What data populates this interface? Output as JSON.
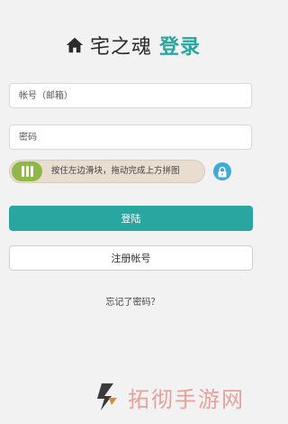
{
  "header": {
    "home_icon": "home-icon",
    "site_name": "宅之魂",
    "title": "登录"
  },
  "form": {
    "account_placeholder": "帐号（邮箱）",
    "password_placeholder": "密码"
  },
  "slider": {
    "hint": "按住左边滑块，拖动完成上方拼图",
    "knob_icon": "grip-icon",
    "lock_icon": "lock-icon",
    "knob_color": "#8fb847",
    "track_color": "#e9ddd0",
    "lock_color": "#3fa9d9"
  },
  "actions": {
    "login_label": "登陆",
    "register_label": "注册帐号",
    "forgot_label": "忘记了密码？"
  },
  "colors": {
    "accent": "#2aa6a0",
    "background": "#f2f2f2"
  },
  "watermark": {
    "text": "拓彻手游网"
  }
}
